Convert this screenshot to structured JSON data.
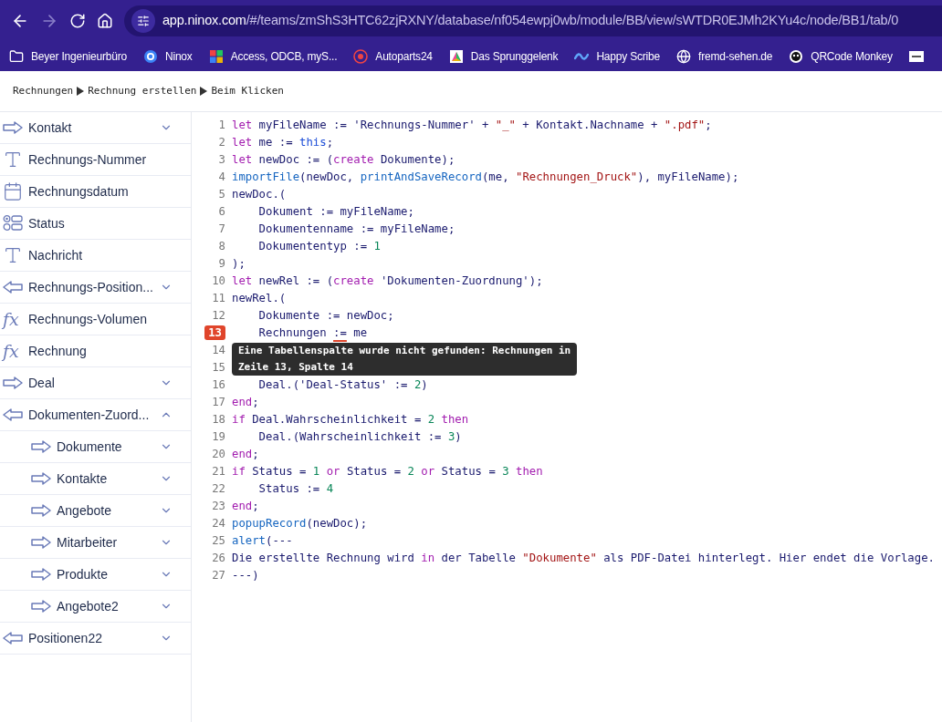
{
  "browser": {
    "url_host": "app.ninox.com",
    "url_path": "/#/teams/zmShS3HTC62zjRXNY/database/nf054ewpj0wb/module/BB/view/sWTDR0EJMh2KYu4c/node/BB1/tab/0",
    "bookmarks": [
      {
        "kind": "folder",
        "label": "Beyer Ingenieurbüro"
      },
      {
        "kind": "ring",
        "label": "Ninox"
      },
      {
        "kind": "tiles",
        "label": "Access, ODCB, myS..."
      },
      {
        "kind": "badge",
        "label": "Autoparts24"
      },
      {
        "kind": "prism",
        "label": "Das Sprunggelenk"
      },
      {
        "kind": "wave",
        "label": "Happy Scribe"
      },
      {
        "kind": "globe",
        "label": "fremd-sehen.de"
      },
      {
        "kind": "qr",
        "label": "QRCode Monkey"
      },
      {
        "kind": "square"
      }
    ]
  },
  "breadcrumb": [
    "Rechnungen",
    "Rechnung erstellen",
    "Beim Klicken"
  ],
  "sidebar": {
    "items": [
      {
        "kind": "link-out",
        "label": "Kontakt",
        "expanded": false
      },
      {
        "kind": "text",
        "label": "Rechnungs-Nummer"
      },
      {
        "kind": "date",
        "label": "Rechnungsdatum"
      },
      {
        "kind": "choice",
        "label": "Status"
      },
      {
        "kind": "text",
        "label": "Nachricht"
      },
      {
        "kind": "link-in",
        "label": "Rechnungs-Position...",
        "expanded": false
      },
      {
        "kind": "formula",
        "icon": "fx",
        "label": "Rechnungs-Volumen"
      },
      {
        "kind": "formula",
        "icon": "fx",
        "label": "Rechnung"
      },
      {
        "kind": "link-out",
        "label": "Deal",
        "expanded": false
      },
      {
        "kind": "link-in",
        "label": "Dokumenten-Zuord...",
        "expanded": true,
        "children": [
          {
            "kind": "link-out",
            "label": "Dokumente",
            "expanded": false
          },
          {
            "kind": "link-out",
            "label": "Kontakte",
            "expanded": false
          },
          {
            "kind": "link-out",
            "label": "Angebote",
            "expanded": false
          },
          {
            "kind": "link-out",
            "label": "Mitarbeiter",
            "expanded": false
          },
          {
            "kind": "link-out",
            "label": "Produkte",
            "expanded": false
          },
          {
            "kind": "link-out",
            "label": "Angebote2",
            "expanded": false
          }
        ]
      },
      {
        "kind": "link-in",
        "label": "Positionen22",
        "expanded": false
      }
    ]
  },
  "editor": {
    "lines": [
      {
        "number": "1",
        "error": false,
        "tokens": [
          {
            "kind": "keyword",
            "text": "let"
          },
          {
            "kind": "plain",
            "text": " myFileName := 'Rechnungs-Nummer' + "
          },
          {
            "kind": "string",
            "text": "\"_\""
          },
          {
            "kind": "plain",
            "text": " + Kontakt.Nachname + "
          },
          {
            "kind": "string",
            "text": "\".pdf\""
          },
          {
            "kind": "plain",
            "text": ";"
          }
        ]
      },
      {
        "number": "2",
        "error": false,
        "tokens": [
          {
            "kind": "keyword",
            "text": "let"
          },
          {
            "kind": "plain",
            "text": " me := "
          },
          {
            "kind": "builtin",
            "text": "this"
          },
          {
            "kind": "plain",
            "text": ";"
          }
        ]
      },
      {
        "number": "3",
        "error": false,
        "tokens": [
          {
            "kind": "keyword",
            "text": "let"
          },
          {
            "kind": "plain",
            "text": " newDoc := ("
          },
          {
            "kind": "keyword",
            "text": "create"
          },
          {
            "kind": "plain",
            "text": " Dokumente);"
          }
        ]
      },
      {
        "number": "4",
        "error": false,
        "tokens": [
          {
            "kind": "function",
            "text": "importFile"
          },
          {
            "kind": "plain",
            "text": "(newDoc, "
          },
          {
            "kind": "function",
            "text": "printAndSaveRecord"
          },
          {
            "kind": "plain",
            "text": "(me, "
          },
          {
            "kind": "string",
            "text": "\"Rechnungen_Druck\""
          },
          {
            "kind": "plain",
            "text": "), myFileName);"
          }
        ]
      },
      {
        "number": "5",
        "error": false,
        "tokens": [
          {
            "kind": "plain",
            "text": "newDoc.("
          }
        ]
      },
      {
        "number": "6",
        "error": false,
        "tokens": [
          {
            "kind": "plain",
            "text": "    Dokument := myFileName;"
          }
        ]
      },
      {
        "number": "7",
        "error": false,
        "tokens": [
          {
            "kind": "plain",
            "text": "    Dokumentenname := myFileName;"
          }
        ]
      },
      {
        "number": "8",
        "error": false,
        "tokens": [
          {
            "kind": "plain",
            "text": "    Dokumententyp := "
          },
          {
            "kind": "number",
            "text": "1"
          }
        ]
      },
      {
        "number": "9",
        "error": false,
        "tokens": [
          {
            "kind": "plain",
            "text": ");"
          }
        ]
      },
      {
        "number": "10",
        "error": false,
        "tokens": [
          {
            "kind": "keyword",
            "text": "let"
          },
          {
            "kind": "plain",
            "text": " newRel := ("
          },
          {
            "kind": "keyword",
            "text": "create"
          },
          {
            "kind": "plain",
            "text": " 'Dokumenten-Zuordnung');"
          }
        ]
      },
      {
        "number": "11",
        "error": false,
        "tokens": [
          {
            "kind": "plain",
            "text": "newRel.("
          }
        ]
      },
      {
        "number": "12",
        "error": false,
        "tokens": [
          {
            "kind": "plain",
            "text": "    Dokumente := newDoc;"
          }
        ]
      },
      {
        "number": "13",
        "error": true,
        "tokens": [
          {
            "kind": "plain",
            "text": "    Rechnungen "
          },
          {
            "kind": "error",
            "text": ":="
          },
          {
            "kind": "plain",
            "text": " me"
          }
        ]
      },
      {
        "number": "14",
        "error": false
      },
      {
        "number": "15",
        "error": false
      },
      {
        "number": "16",
        "error": false,
        "tokens": [
          {
            "kind": "plain",
            "text": "    Deal.('Deal-Status' := "
          },
          {
            "kind": "number",
            "text": "2"
          },
          {
            "kind": "plain",
            "text": ")"
          }
        ]
      },
      {
        "number": "17",
        "error": false,
        "tokens": [
          {
            "kind": "keyword",
            "text": "end"
          },
          {
            "kind": "plain",
            "text": ";"
          }
        ]
      },
      {
        "number": "18",
        "error": false,
        "tokens": [
          {
            "kind": "keyword",
            "text": "if"
          },
          {
            "kind": "plain",
            "text": " Deal.Wahrscheinlichkeit = "
          },
          {
            "kind": "number",
            "text": "2"
          },
          {
            "kind": "keyword",
            "text": " then"
          }
        ]
      },
      {
        "number": "19",
        "error": false,
        "tokens": [
          {
            "kind": "plain",
            "text": "    Deal.(Wahrscheinlichkeit := "
          },
          {
            "kind": "number",
            "text": "3"
          },
          {
            "kind": "plain",
            "text": ")"
          }
        ]
      },
      {
        "number": "20",
        "error": false,
        "tokens": [
          {
            "kind": "keyword",
            "text": "end"
          },
          {
            "kind": "plain",
            "text": ";"
          }
        ]
      },
      {
        "number": "21",
        "error": false,
        "tokens": [
          {
            "kind": "keyword",
            "text": "if"
          },
          {
            "kind": "plain",
            "text": " Status = "
          },
          {
            "kind": "number",
            "text": "1"
          },
          {
            "kind": "keyword",
            "text": " or"
          },
          {
            "kind": "plain",
            "text": " Status = "
          },
          {
            "kind": "number",
            "text": "2"
          },
          {
            "kind": "keyword",
            "text": " or"
          },
          {
            "kind": "plain",
            "text": " Status = "
          },
          {
            "kind": "number",
            "text": "3"
          },
          {
            "kind": "keyword",
            "text": " then"
          }
        ]
      },
      {
        "number": "22",
        "error": false,
        "tokens": [
          {
            "kind": "plain",
            "text": "    Status := "
          },
          {
            "kind": "number",
            "text": "4"
          }
        ]
      },
      {
        "number": "23",
        "error": false,
        "tokens": [
          {
            "kind": "keyword",
            "text": "end"
          },
          {
            "kind": "plain",
            "text": ";"
          }
        ]
      },
      {
        "number": "24",
        "error": false,
        "tokens": [
          {
            "kind": "function",
            "text": "popupRecord"
          },
          {
            "kind": "plain",
            "text": "(newDoc);"
          }
        ]
      },
      {
        "number": "25",
        "error": false,
        "tokens": [
          {
            "kind": "function",
            "text": "alert"
          },
          {
            "kind": "plain",
            "text": "(---"
          }
        ]
      },
      {
        "number": "26",
        "error": false,
        "tokens": [
          {
            "kind": "plain",
            "text": "Die erstellte Rechnung wird "
          },
          {
            "kind": "keyword",
            "text": "in"
          },
          {
            "kind": "plain",
            "text": " der Tabelle "
          },
          {
            "kind": "string",
            "text": "\"Dokumente\""
          },
          {
            "kind": "plain",
            "text": " als PDF-Datei hinterlegt. Hier endet die Vorlage."
          }
        ]
      },
      {
        "number": "27",
        "error": false,
        "tokens": [
          {
            "kind": "plain",
            "text": "---)"
          }
        ]
      }
    ],
    "tooltip": {
      "lines": [
        "Eine Tabellenspalte wurde nicht gefunden: Rechnungen in",
        "Zeile 13, Spalte 14"
      ]
    }
  }
}
